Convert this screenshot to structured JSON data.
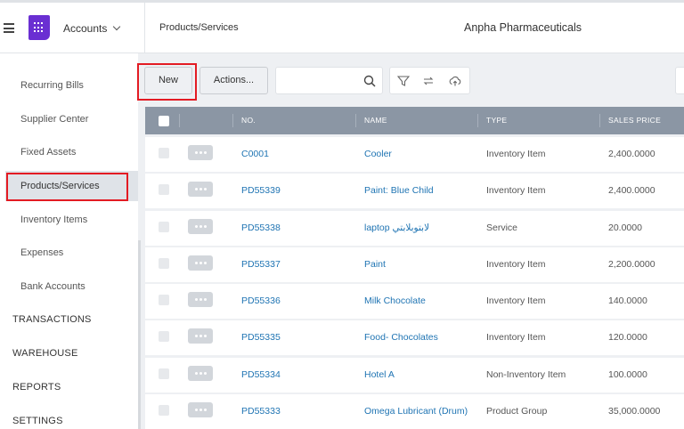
{
  "header": {
    "module": "Accounts",
    "page_crumb": "Products/Services",
    "company": "Anpha Pharmaceuticals"
  },
  "sidebar": {
    "items": [
      {
        "label": "Recurring Bills"
      },
      {
        "label": "Supplier Center"
      },
      {
        "label": "Fixed Assets"
      },
      {
        "label": "Products/Services",
        "active": true
      },
      {
        "label": "Inventory Items"
      },
      {
        "label": "Expenses"
      },
      {
        "label": "Bank Accounts"
      }
    ],
    "sections": [
      {
        "label": "TRANSACTIONS"
      },
      {
        "label": "WAREHOUSE"
      },
      {
        "label": "REPORTS"
      },
      {
        "label": "SETTINGS"
      }
    ]
  },
  "toolbar": {
    "new_label": "New",
    "actions_label": "Actions...",
    "search_value": ""
  },
  "table": {
    "columns": [
      "NO.",
      "NAME",
      "TYPE",
      "SALES PRICE"
    ],
    "rows": [
      {
        "no": "C0001",
        "name": "Cooler",
        "type": "Inventory Item",
        "price": "2,400.0000"
      },
      {
        "no": "PD55339",
        "name": "Paint: Blue Child",
        "type": "Inventory Item",
        "price": "2,400.0000"
      },
      {
        "no": "PD55338",
        "name": "laptop لابتوبلابتي",
        "type": "Service",
        "price": "20.0000"
      },
      {
        "no": "PD55337",
        "name": "Paint",
        "type": "Inventory Item",
        "price": "2,200.0000"
      },
      {
        "no": "PD55336",
        "name": "Milk Chocolate",
        "type": "Inventory Item",
        "price": "140.0000"
      },
      {
        "no": "PD55335",
        "name": "Food- Chocolates",
        "type": "Inventory Item",
        "price": "120.0000"
      },
      {
        "no": "PD55334",
        "name": "Hotel A",
        "type": "Non-Inventory Item",
        "price": "100.0000"
      },
      {
        "no": "PD55333",
        "name": "Omega Lubricant (Drum)",
        "type": "Product Group",
        "price": "35,000.0000"
      }
    ]
  },
  "colors": {
    "accent": "#6a2fd2",
    "link": "#1f74b3",
    "table_header": "#8b96a4",
    "highlight": "#e31b23"
  }
}
